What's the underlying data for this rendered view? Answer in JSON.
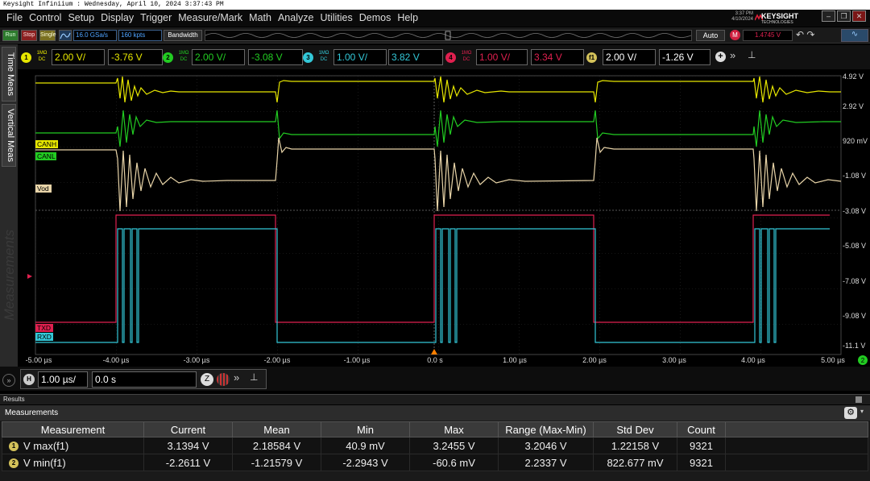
{
  "titlebar": {
    "text": "Keysight Infiniium : Wednesday, April 10, 2024 3:37:43 PM"
  },
  "menu": [
    "File",
    "Control",
    "Setup",
    "Display",
    "Trigger",
    "Measure/Mark",
    "Math",
    "Analyze",
    "Utilities",
    "Demos",
    "Help"
  ],
  "clock": {
    "time": "3:37 PM",
    "date": "4/10/2024"
  },
  "brand": {
    "name": "KEYSIGHT",
    "sub": "TECHNOLOGIES"
  },
  "toolbar": {
    "run": "Run",
    "stop": "Stop",
    "single": "Single",
    "sample_rate": "16.0 GSa/s",
    "memory": "160 kpts",
    "bandwidth": "Bandwidth",
    "auto": "Auto",
    "trigger_level": "1.4745 V"
  },
  "channels": [
    {
      "num": "1",
      "coupling": "1MΩ DC",
      "scale": "2.00 V/",
      "offset": "-3.76 V",
      "color": "#e6e600"
    },
    {
      "num": "2",
      "coupling": "1MΩ DC",
      "scale": "2.00 V/",
      "offset": "-3.08 V",
      "color": "#22cc22"
    },
    {
      "num": "3",
      "coupling": "1MΩ DC",
      "scale": "1.00 V/",
      "offset": "3.82 V",
      "color": "#33c8d8"
    },
    {
      "num": "4",
      "coupling": "1MΩ DC",
      "scale": "1.00 V/",
      "offset": "3.34 V",
      "color": "#e0204f"
    },
    {
      "num": "f1",
      "coupling": "",
      "scale": "2.00 V/",
      "offset": "-1.26 V",
      "color": "#e8d4a8"
    }
  ],
  "side_tabs": {
    "time": "Time Meas",
    "vertical": "Vertical Meas",
    "watermark": "Measurements"
  },
  "screen": {
    "y_labels": [
      "4.92 V",
      "2.92 V",
      "920 mV",
      "-1.08 V",
      "-3.08 V",
      "-5.08 V",
      "-7.08 V",
      "-9.08 V",
      "-11.1 V"
    ],
    "x_labels": [
      "-5.00 µs",
      "-4.00 µs",
      "-3.00 µs",
      "-2.00 µs",
      "-1.00 µs",
      "0.0 s",
      "1.00 µs",
      "2.00 µs",
      "3.00 µs",
      "4.00 µs",
      "5.00 µs"
    ],
    "trace_labels": {
      "canh": "CANH",
      "canl": "CANL",
      "vod": "Vod",
      "txd": "TXD",
      "rxd": "RXD"
    },
    "corner_badge": "2"
  },
  "horizontal": {
    "scale": "1.00 µs/",
    "position": "0.0 s"
  },
  "results": {
    "header": "Results",
    "panel_title": "Measurements"
  },
  "measurements": {
    "columns": [
      "Measurement",
      "Current",
      "Mean",
      "Min",
      "Max",
      "Range (Max-Min)",
      "Std Dev",
      "Count"
    ],
    "rows": [
      {
        "badge": "1",
        "name": "V max(f1)",
        "current": "3.1394 V",
        "mean": "2.18584 V",
        "min": "40.9 mV",
        "max": "3.2455 V",
        "range": "3.2046 V",
        "stddev": "1.22158 V",
        "count": "9321"
      },
      {
        "badge": "2",
        "name": "V min(f1)",
        "current": "-2.2611 V",
        "mean": "-1.21579 V",
        "min": "-2.2943 V",
        "max": "-60.6 mV",
        "range": "2.2337 V",
        "stddev": "822.677 mV",
        "count": "9321"
      }
    ]
  }
}
